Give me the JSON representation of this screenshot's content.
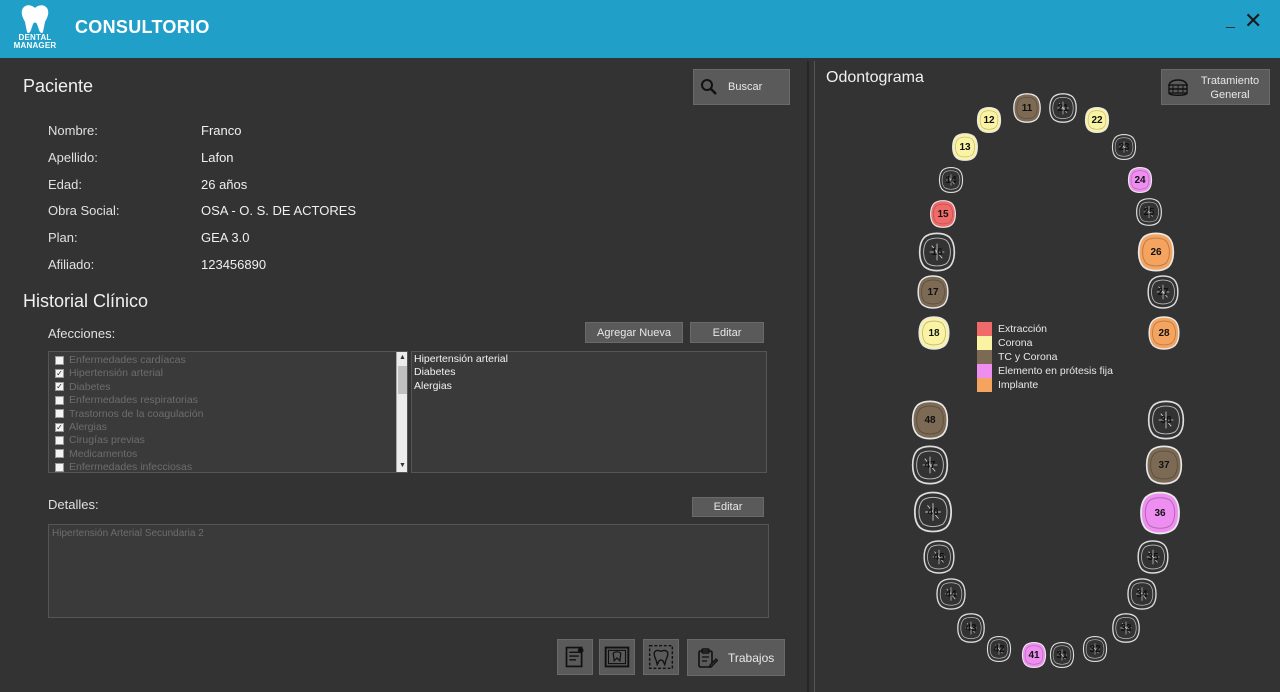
{
  "app": {
    "title": "CONSULTORIO",
    "logo_text": [
      "DENTAL",
      "MANAGER"
    ],
    "minimize": "_",
    "close": "✕"
  },
  "paciente": {
    "heading": "Paciente",
    "buscar": "Buscar",
    "fields": [
      {
        "label": "Nombre:",
        "value": "Franco"
      },
      {
        "label": "Apellido:",
        "value": "Lafon"
      },
      {
        "label": "Edad:",
        "value": "26 años"
      },
      {
        "label": "Obra Social:",
        "value": "OSA - O. S. DE ACTORES"
      },
      {
        "label": "Plan:",
        "value": "GEA 3.0"
      },
      {
        "label": "Afiliado:",
        "value": "123456890"
      }
    ]
  },
  "historial": {
    "heading": "Historial Clínico",
    "afecciones_label": "Afecciones:",
    "agregar": "Agregar Nueva",
    "editar": "Editar",
    "afecciones": [
      {
        "label": "Enfermedades cardíacas",
        "checked": false
      },
      {
        "label": "Hipertensión arterial",
        "checked": true
      },
      {
        "label": "Diabetes",
        "checked": true
      },
      {
        "label": "Enfermedades respiratorias",
        "checked": false
      },
      {
        "label": "Trastornos de la coagulación",
        "checked": false
      },
      {
        "label": "Alergias",
        "checked": true
      },
      {
        "label": "Cirugías previas",
        "checked": false
      },
      {
        "label": "Medicamentos",
        "checked": false
      },
      {
        "label": "Enfermedades infecciosas",
        "checked": false
      }
    ],
    "seleccionadas": [
      "Hipertensión arterial",
      "Diabetes",
      "Alergias"
    ],
    "detalles_label": "Detalles:",
    "detalles_editar": "Editar",
    "detalles_text": "Hipertensión Arterial Secundaria 2"
  },
  "actions": {
    "trabajos": "Trabajos"
  },
  "odontograma": {
    "heading": "Odontograma",
    "tratamiento": [
      "Tratamiento",
      "General"
    ],
    "colors": {
      "extraccion": "#f06a6a",
      "corona": "#fbf3a4",
      "tc_corona": "#7c6a55",
      "protesis": "#ee8ef0",
      "implante": "#f5a460",
      "sano": "#333333"
    },
    "legend": [
      {
        "label": "Extracción",
        "state": "extraccion"
      },
      {
        "label": "Corona",
        "state": "corona"
      },
      {
        "label": "TC y Corona",
        "state": "tc_corona"
      },
      {
        "label": "Elemento en prótesis fija",
        "state": "protesis"
      },
      {
        "label": "Implante",
        "state": "implante"
      }
    ],
    "teeth": [
      {
        "n": "11",
        "state": "tc_corona"
      },
      {
        "n": "21",
        "state": "sano"
      },
      {
        "n": "12",
        "state": "corona"
      },
      {
        "n": "22",
        "state": "corona"
      },
      {
        "n": "13",
        "state": "corona"
      },
      {
        "n": "23",
        "state": "sano"
      },
      {
        "n": "14",
        "state": "sano"
      },
      {
        "n": "24",
        "state": "protesis"
      },
      {
        "n": "15",
        "state": "extraccion"
      },
      {
        "n": "25",
        "state": "sano"
      },
      {
        "n": "16",
        "state": "sano"
      },
      {
        "n": "26",
        "state": "implante"
      },
      {
        "n": "17",
        "state": "tc_corona"
      },
      {
        "n": "27",
        "state": "sano"
      },
      {
        "n": "18",
        "state": "corona"
      },
      {
        "n": "28",
        "state": "implante"
      },
      {
        "n": "48",
        "state": "tc_corona"
      },
      {
        "n": "38",
        "state": "sano"
      },
      {
        "n": "47",
        "state": "sano"
      },
      {
        "n": "37",
        "state": "tc_corona"
      },
      {
        "n": "46",
        "state": "sano"
      },
      {
        "n": "36",
        "state": "protesis"
      },
      {
        "n": "45",
        "state": "sano"
      },
      {
        "n": "35",
        "state": "sano"
      },
      {
        "n": "44",
        "state": "sano"
      },
      {
        "n": "34",
        "state": "sano"
      },
      {
        "n": "43",
        "state": "sano"
      },
      {
        "n": "33",
        "state": "sano"
      },
      {
        "n": "42",
        "state": "sano"
      },
      {
        "n": "32",
        "state": "sano"
      },
      {
        "n": "41",
        "state": "protesis"
      },
      {
        "n": "31",
        "state": "sano"
      }
    ]
  }
}
